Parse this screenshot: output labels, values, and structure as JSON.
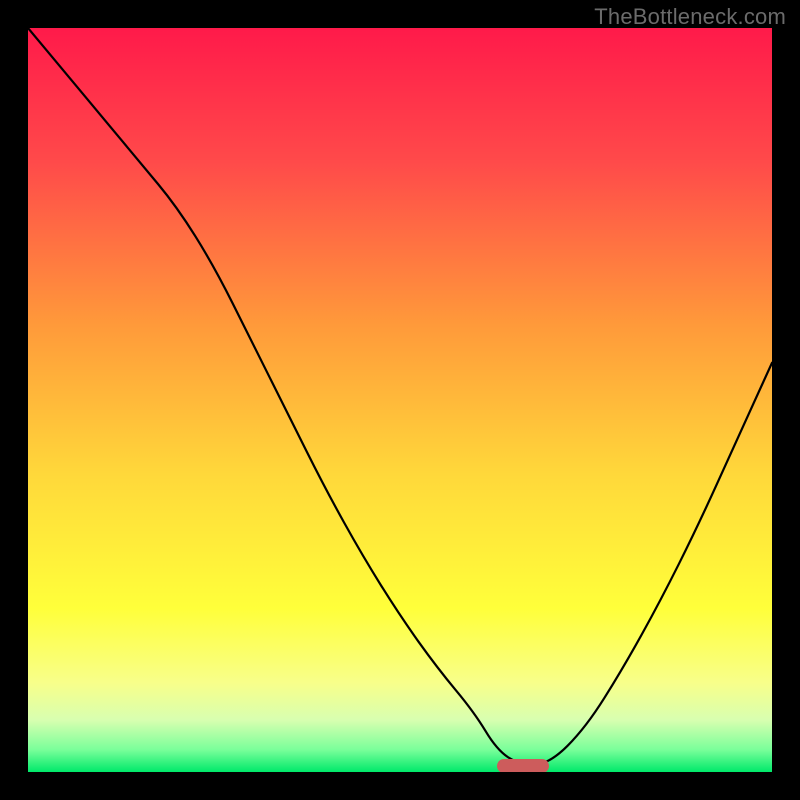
{
  "watermark": "TheBottleneck.com",
  "chart_data": {
    "type": "line",
    "title": "",
    "xlabel": "",
    "ylabel": "",
    "xlim": [
      0,
      100
    ],
    "ylim": [
      0,
      100
    ],
    "x": [
      0,
      5,
      10,
      15,
      20,
      25,
      30,
      35,
      40,
      45,
      50,
      55,
      60,
      63,
      66,
      70,
      75,
      80,
      85,
      90,
      95,
      100
    ],
    "values": [
      100,
      94,
      88,
      82,
      76,
      68,
      58,
      48,
      38,
      29,
      21,
      14,
      8,
      3,
      1,
      1,
      6,
      14,
      23,
      33,
      44,
      55
    ],
    "marker": {
      "x_start": 63,
      "x_end": 70,
      "y": 0.8
    },
    "gradient_stops": [
      {
        "pos": 0,
        "color": "#ff1a4a"
      },
      {
        "pos": 18,
        "color": "#ff4a4a"
      },
      {
        "pos": 40,
        "color": "#ff9a3a"
      },
      {
        "pos": 60,
        "color": "#ffd83a"
      },
      {
        "pos": 78,
        "color": "#ffff3a"
      },
      {
        "pos": 88,
        "color": "#f8ff8a"
      },
      {
        "pos": 93,
        "color": "#d8ffb0"
      },
      {
        "pos": 97,
        "color": "#7aff9a"
      },
      {
        "pos": 100,
        "color": "#00e96a"
      }
    ]
  }
}
